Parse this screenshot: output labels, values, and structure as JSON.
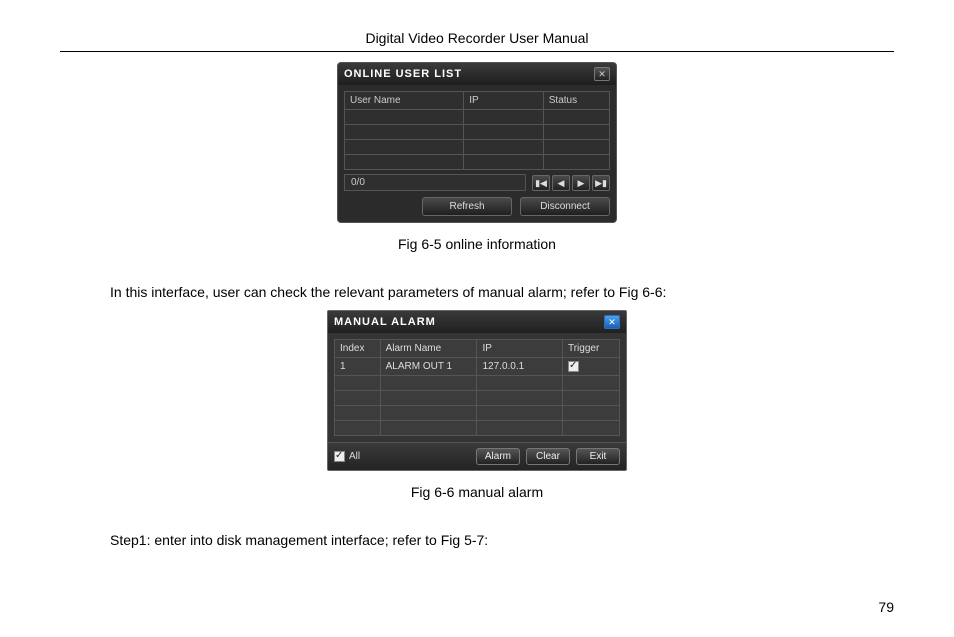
{
  "doc": {
    "title": "Digital Video Recorder User Manual",
    "page_number": "79"
  },
  "fig1": {
    "dialog_title": "ONLINE USER LIST",
    "close_glyph": "✕",
    "columns": {
      "user_name": "User Name",
      "ip": "IP",
      "status": "Status"
    },
    "pager_text": "0/0",
    "pager_btns": {
      "first": "▮◀",
      "prev": "◀",
      "next": "▶",
      "last": "▶▮"
    },
    "refresh_label": "Refresh",
    "disconnect_label": "Disconnect",
    "caption": "Fig 6-5 online information"
  },
  "intertext": "In this interface, user can check the relevant parameters of manual alarm; refer to Fig 6-6:",
  "fig2": {
    "dialog_title": "MANUAL  ALARM",
    "close_glyph": "✕",
    "columns": {
      "index": "Index",
      "alarm_name": "Alarm  Name",
      "ip": "IP",
      "trigger": "Trigger"
    },
    "rows": [
      {
        "index": "1",
        "alarm_name": "ALARM  OUT  1",
        "ip": "127.0.0.1",
        "trigger_checked": true
      }
    ],
    "all_label": "All",
    "all_checked": true,
    "alarm_label": "Alarm",
    "clear_label": "Clear",
    "exit_label": "Exit",
    "caption": "Fig 6-6 manual alarm"
  },
  "step_text": "Step1: enter into disk management interface; refer to Fig 5-7:"
}
